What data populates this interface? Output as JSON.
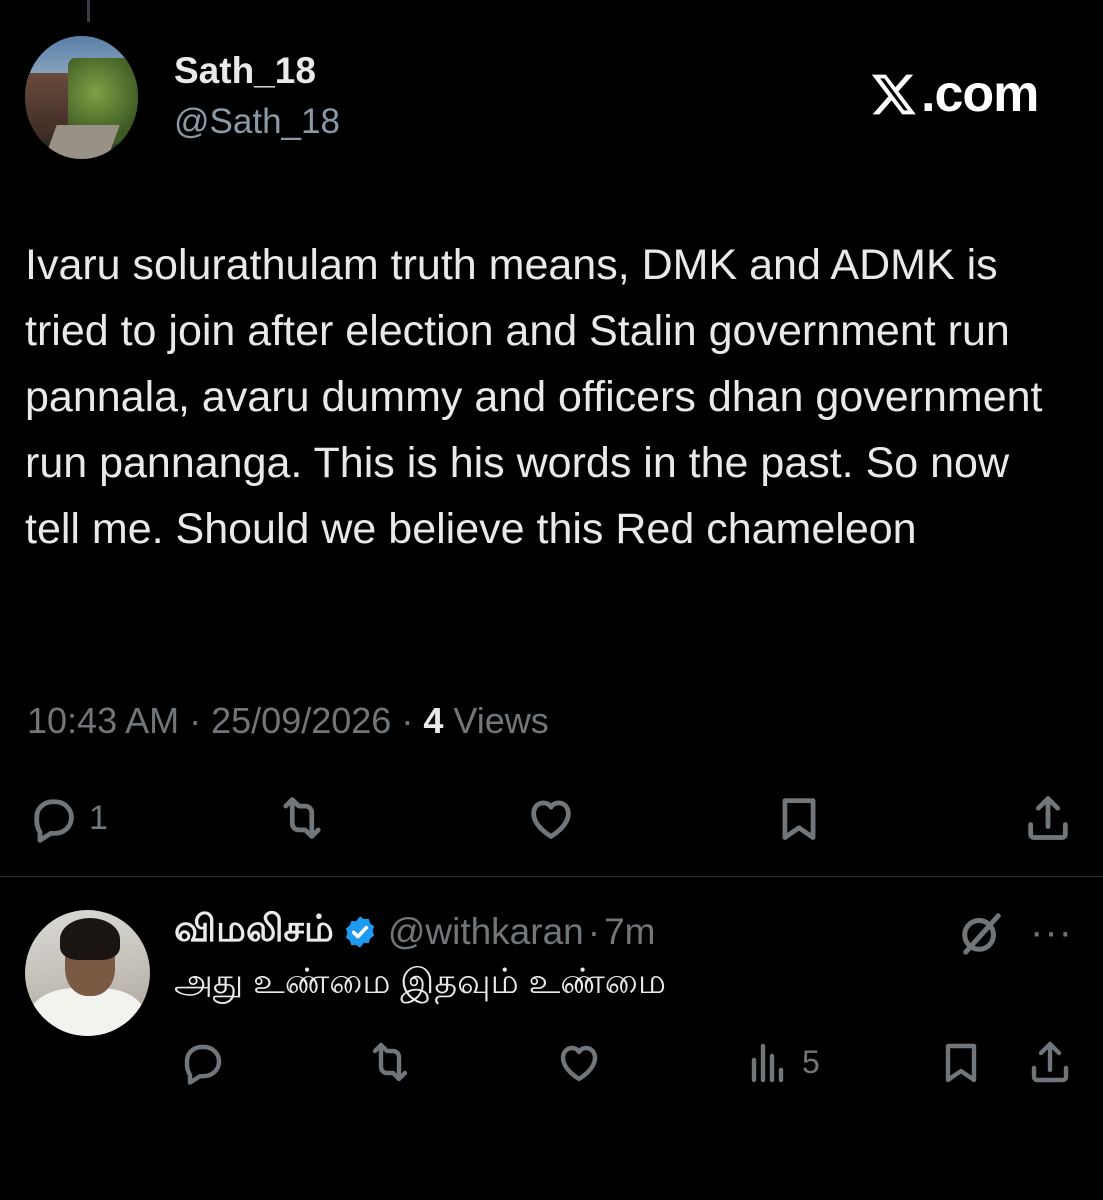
{
  "brand": {
    "site": ".com"
  },
  "main_tweet": {
    "display_name": "Sath_18",
    "handle": "@Sath_18",
    "text": "Ivaru solurathulam truth means, DMK and ADMK is tried to join after election and Stalin government run pannala, avaru dummy and officers dhan government run pannanga. This is his words in the past. So now tell me. Should we believe this Red chameleon",
    "time": "10:43 AM",
    "date": "25/09/2026",
    "views_count": "4",
    "views_label": "Views",
    "separator": "·",
    "replies": "1"
  },
  "reply": {
    "display_name": "விமலிசம்",
    "handle": "@withkaran",
    "separator": "·",
    "age": "7m",
    "text": "அது உண்மை இதவும் உண்மை",
    "views": "5",
    "more": "···"
  },
  "icons": {
    "reply": "reply-icon",
    "retweet": "retweet-icon",
    "like": "heart-icon",
    "bookmark": "bookmark-icon",
    "share": "share-icon",
    "analytics": "analytics-icon",
    "grok": "grok-icon",
    "verified": "verified-badge-icon"
  },
  "colors": {
    "background": "#000000",
    "text": "#e7e9ea",
    "muted": "#71767b",
    "verified": "#1d9bf0"
  }
}
